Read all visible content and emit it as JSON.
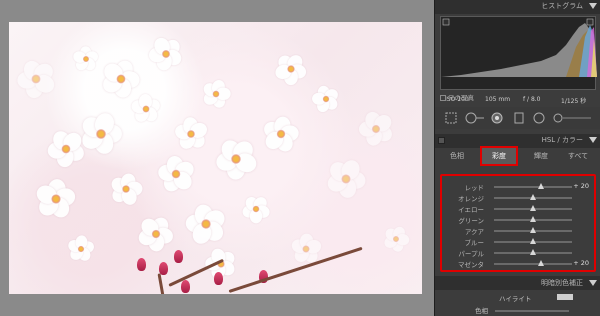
{
  "histogram_panel": {
    "title": "ヒストグラム",
    "iso": "ISO 100",
    "focal": "105 mm",
    "aperture": "f / 8.0",
    "shutter": "1/125 秒",
    "original_photo_label": "元の写真"
  },
  "hsl_panel": {
    "title": "HSL / カラー",
    "tabs": [
      {
        "label": "色相"
      },
      {
        "label": "彩度",
        "active": true
      },
      {
        "label": "輝度"
      },
      {
        "label": "すべて"
      }
    ],
    "sliders": [
      {
        "label": "レッド",
        "value": "+ 20",
        "level": 0.6
      },
      {
        "label": "オレンジ",
        "value": "0",
        "level": 0.5
      },
      {
        "label": "イエロー",
        "value": "0",
        "level": 0.5
      },
      {
        "label": "グリーン",
        "value": "0",
        "level": 0.5
      },
      {
        "label": "アクア",
        "value": "0",
        "level": 0.5
      },
      {
        "label": "ブルー",
        "value": "0",
        "level": 0.5
      },
      {
        "label": "パープル",
        "value": "0",
        "level": 0.5
      },
      {
        "label": "マゼンタ",
        "value": "+ 20",
        "level": 0.6
      }
    ]
  },
  "split_toning": {
    "title": "明暗別色補正",
    "highlight_label": "ハイライト",
    "hue_label": "色相"
  },
  "colors": {
    "highlight_red": "#e00000",
    "panel_bg": "#3c3c3c",
    "viewer_bg": "#8a8a8a"
  }
}
